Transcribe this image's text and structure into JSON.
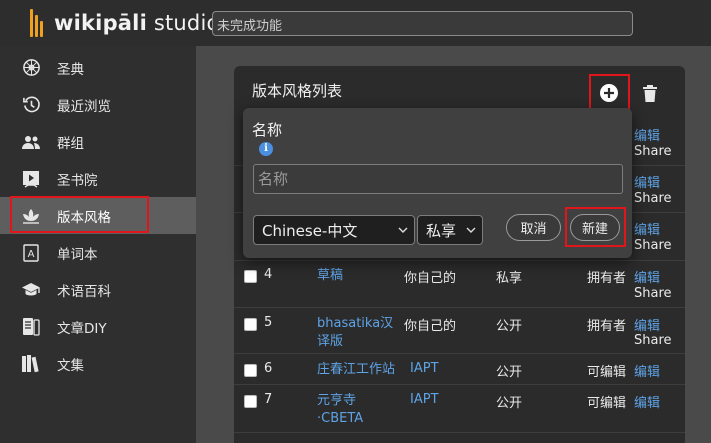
{
  "app": {
    "logo_bold": "wikipāli",
    "logo_rest": " studio"
  },
  "search": {
    "value": "未完成功能"
  },
  "sidebar": {
    "items": [
      {
        "label": "圣典",
        "icon": "dharma-wheel-icon"
      },
      {
        "label": "最近浏览",
        "icon": "history-icon"
      },
      {
        "label": "群组",
        "icon": "group-icon"
      },
      {
        "label": "圣书院",
        "icon": "play-book-icon"
      },
      {
        "label": "版本风格",
        "icon": "lotus-icon",
        "active": true
      },
      {
        "label": "单词本",
        "icon": "dictionary-icon"
      },
      {
        "label": "术语百科",
        "icon": "graduation-cap-icon"
      },
      {
        "label": "文章DIY",
        "icon": "article-icon"
      },
      {
        "label": "文集",
        "icon": "books-icon"
      }
    ]
  },
  "main": {
    "title": "版本风格列表",
    "rows_partial": [
      {
        "edit": "编辑",
        "share": "Share"
      },
      {
        "edit": "编辑",
        "share": "Share"
      },
      {
        "edit": "编辑",
        "share": "Share"
      }
    ],
    "rows": [
      {
        "num": "4",
        "title": "草稿",
        "owner": "你自己的",
        "owner_link": false,
        "privacy": "私享",
        "role": "拥有者",
        "edit": "编辑",
        "share": "Share"
      },
      {
        "num": "5",
        "title": "bhasatika汉译版",
        "owner": "你自己的",
        "owner_link": false,
        "privacy": "公开",
        "role": "拥有者",
        "edit": "编辑",
        "share": "Share"
      },
      {
        "num": "6",
        "title": "庄春江工作站",
        "owner": "IAPT",
        "owner_link": true,
        "privacy": "公开",
        "role": "可编辑",
        "edit": "编辑",
        "share": ""
      },
      {
        "num": "7",
        "title": "元亨寺·CBETA",
        "owner": "IAPT",
        "owner_link": true,
        "privacy": "公开",
        "role": "可编辑",
        "edit": "编辑",
        "share": ""
      }
    ]
  },
  "popover": {
    "label": "名称",
    "info_icon": "info-icon",
    "input_placeholder": "名称",
    "language": "Chinese-中文",
    "privacy": "私享",
    "cancel": "取消",
    "create": "新建"
  },
  "colors": {
    "accent_link": "#5ea3e6",
    "highlight": "#e0161b",
    "logo": "#f0a020"
  }
}
